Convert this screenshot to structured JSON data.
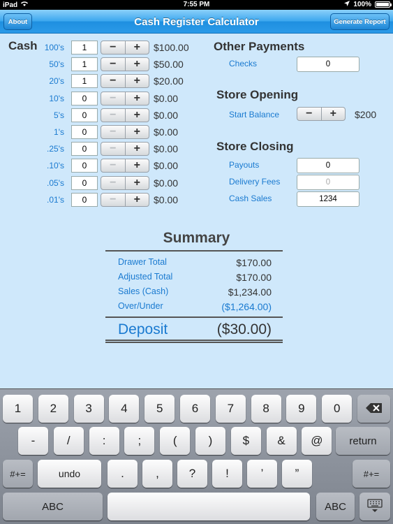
{
  "status": {
    "device": "iPad",
    "time": "7:55 PM",
    "battery": "100%"
  },
  "nav": {
    "about": "About",
    "title": "Cash Register Calculator",
    "report": "Generate Report"
  },
  "cash": {
    "title": "Cash",
    "rows": [
      {
        "denom": "100's",
        "qty": "1",
        "amount": "$100.00"
      },
      {
        "denom": "50's",
        "qty": "1",
        "amount": "$50.00"
      },
      {
        "denom": "20's",
        "qty": "1",
        "amount": "$20.00"
      },
      {
        "denom": "10's",
        "qty": "0",
        "amount": "$0.00"
      },
      {
        "denom": "5's",
        "qty": "0",
        "amount": "$0.00"
      },
      {
        "denom": "1's",
        "qty": "0",
        "amount": "$0.00"
      },
      {
        "denom": ".25's",
        "qty": "0",
        "amount": "$0.00"
      },
      {
        "denom": ".10's",
        "qty": "0",
        "amount": "$0.00"
      },
      {
        "denom": ".05's",
        "qty": "0",
        "amount": "$0.00"
      },
      {
        "denom": ".01's",
        "qty": "0",
        "amount": "$0.00"
      }
    ],
    "minus": "−",
    "plus": "+"
  },
  "other": {
    "title": "Other Payments",
    "checks_label": "Checks",
    "checks_value": "0"
  },
  "opening": {
    "title": "Store Opening",
    "start_label": "Start Balance",
    "start_value": "$200"
  },
  "closing": {
    "title": "Store Closing",
    "payouts_label": "Payouts",
    "payouts_value": "0",
    "delivery_label": "Delivery Fees",
    "delivery_placeholder": "0",
    "sales_label": "Cash Sales",
    "sales_value": "1234"
  },
  "summary": {
    "title": "Summary",
    "rows": [
      {
        "label": "Drawer Total",
        "value": "$170.00"
      },
      {
        "label": "Adjusted Total",
        "value": "$170.00"
      },
      {
        "label": "Sales (Cash)",
        "value": "$1,234.00"
      },
      {
        "label": "Over/Under",
        "value": "($1,264.00)"
      }
    ],
    "deposit_label": "Deposit",
    "deposit_value": "($30.00)"
  },
  "keyboard": {
    "row1": [
      "1",
      "2",
      "3",
      "4",
      "5",
      "6",
      "7",
      "8",
      "9",
      "0"
    ],
    "row2": [
      "-",
      "/",
      ":",
      ";",
      "(",
      ")",
      "$",
      "&",
      "@"
    ],
    "return": "return",
    "row3_left": "#+=",
    "undo": "undo",
    "row3": [
      ".",
      ",",
      "?",
      "!",
      "’",
      "”"
    ],
    "row3_right": "#+=",
    "abc_left": "ABC",
    "abc_right": "ABC"
  },
  "colors": {
    "accent": "#1a7ad0",
    "nav_top": "#8cd0fa",
    "nav_bottom": "#2b9ae8",
    "background": "#cfe8fb"
  },
  "icons": [
    "wifi-icon",
    "location-arrow-icon",
    "battery-icon",
    "backspace-icon",
    "keyboard-dismiss-icon"
  ]
}
